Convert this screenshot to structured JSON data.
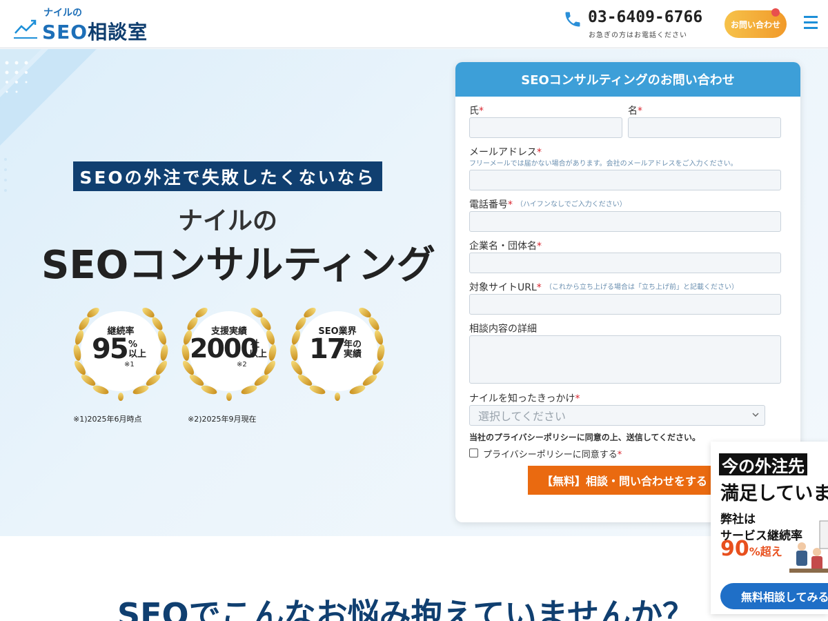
{
  "header": {
    "logo_sub": "ナイルの",
    "logo_seo": "SEO",
    "logo_main": "相談室",
    "phone_number": "03-6409-6766",
    "phone_note": "お急ぎの方はお電話ください",
    "contact_label": "お問い合わせ"
  },
  "hero": {
    "tagline": "SEOの外注で失敗したくないなら",
    "title_sub": "ナイルの",
    "title_main": "SEOコンサルティング",
    "badges": [
      {
        "label": "継続率",
        "number": "95",
        "unit1": "%",
        "unit2": "以上",
        "note": "※1"
      },
      {
        "label": "支援実績",
        "number": "2000",
        "unit1": "社",
        "unit2": "以上",
        "note": "※2"
      },
      {
        "label": "SEO業界",
        "number": "17",
        "unit1": "年の",
        "unit2": "実績",
        "note": ""
      }
    ],
    "footnotes": [
      "※1)2025年6月時点",
      "※2)2025年9月現在"
    ]
  },
  "form": {
    "title": "SEOコンサルティングのお問い合わせ",
    "required_mark": "*",
    "last_name": "氏",
    "first_name": "名",
    "email_label": "メールアドレス",
    "email_hint": "フリーメールでは届かない場合があります。会社のメールアドレスをご入力ください。",
    "phone_label": "電話番号",
    "phone_hint": "（ハイフンなしでご入力ください）",
    "company_label": "企業名・団体名",
    "site_label": "対象サイトURL",
    "site_hint": "（これから立ち上げる場合は「立ち上げ前」と記載ください）",
    "detail_label": "相談内容の詳細",
    "source_label": "ナイルを知ったきっかけ",
    "source_placeholder": "選択してください",
    "privacy_note": "当社のプライバシーポリシーに同意の上、送信してください。",
    "privacy_agree": "プライバシーポリシーに同意する",
    "submit": "【無料】相談・問い合わせをする"
  },
  "float_banner": {
    "title1": "今の外注先",
    "title2": "満足していますか",
    "line1": "弊社は",
    "line2": "サービス継続率",
    "line3_num": "90",
    "line3_unit": "%超え",
    "button": "無料相談してみる"
  },
  "section": {
    "title": "SEOでこんなお悩み抱えていませんか？"
  }
}
